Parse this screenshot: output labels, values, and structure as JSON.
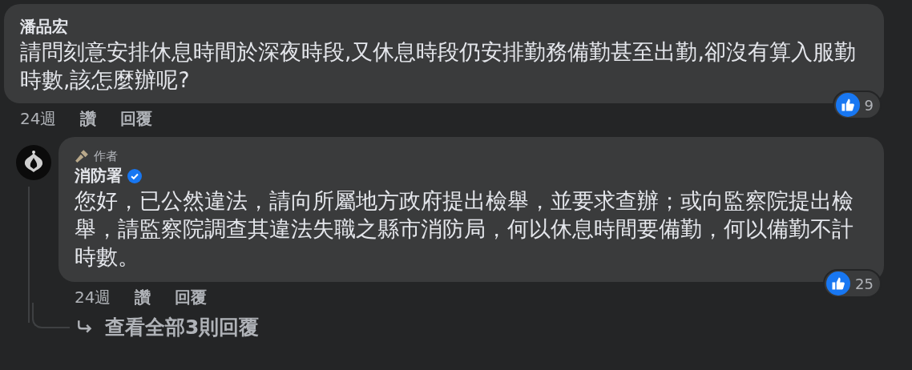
{
  "comments": [
    {
      "author": "潘品宏",
      "verified": false,
      "lines": [
        "請問刻意安排休息時間於深夜時段,又休息時段仍安排勤務備勤甚至出勤,卻沒有算入服勤",
        "時數,該怎麼辦呢?"
      ],
      "reactions": "9",
      "time": "24週",
      "like": "讚",
      "reply": "回覆",
      "avatar": false
    },
    {
      "author": "消防署",
      "author_badge": "作者",
      "verified": true,
      "lines": [
        "您好，已公然違法，請向所屬地方政府提出檢舉，並要求查辦；或向監察院提出檢",
        "舉，請監察院調查其違法失職之縣市消防局，何以休息時間要備勤，何以備勤不計",
        "時數。"
      ],
      "reactions": "25",
      "time": "24週",
      "like": "讚",
      "reply": "回覆",
      "avatar": true
    }
  ],
  "view_replies": "查看全部3則回覆"
}
